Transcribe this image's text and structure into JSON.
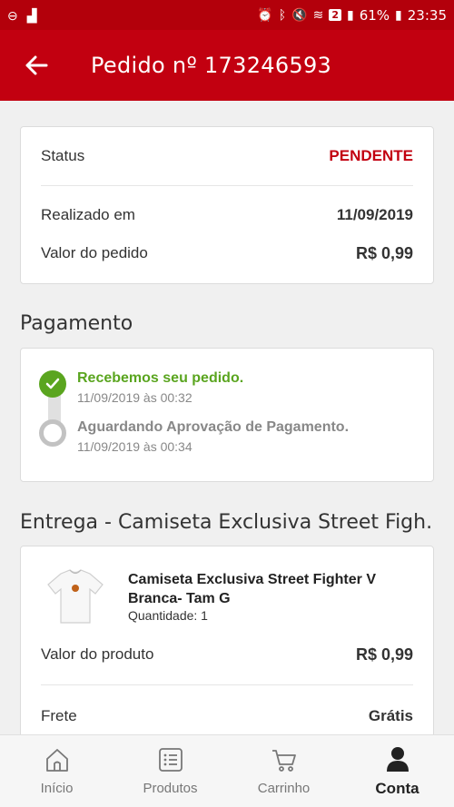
{
  "status_bar": {
    "battery": "61%",
    "time": "23:35",
    "notif_badge": "2"
  },
  "header": {
    "title": "Pedido nº 173246593"
  },
  "order": {
    "status_label": "Status",
    "status_value": "PENDENTE",
    "date_label": "Realizado em",
    "date_value": "11/09/2019",
    "total_label": "Valor do pedido",
    "total_value": "R$ 0,99"
  },
  "payment": {
    "section_title": "Pagamento",
    "steps": [
      {
        "title": "Recebemos seu pedido.",
        "date": "11/09/2019 às 00:32",
        "done": true
      },
      {
        "title": "Aguardando Aprovação de Pagamento.",
        "date": "11/09/2019 às 00:34",
        "done": false
      }
    ]
  },
  "delivery": {
    "section_title": "Entrega - Camiseta Exclusiva Street Figh...",
    "product_name": "Camiseta Exclusiva Street Fighter V Branca- Tam G",
    "quantity": "Quantidade: 1",
    "product_value_label": "Valor do produto",
    "product_value": "R$ 0,99",
    "shipping_label": "Frete",
    "shipping_value": "Grátis"
  },
  "bottom_nav": {
    "items": [
      {
        "label": "Início",
        "icon": "home-icon"
      },
      {
        "label": "Produtos",
        "icon": "list-icon"
      },
      {
        "label": "Carrinho",
        "icon": "cart-icon"
      },
      {
        "label": "Conta",
        "icon": "user-icon",
        "active": true
      }
    ]
  },
  "colors": {
    "brand_red": "#c20010",
    "status_pending": "#c20010",
    "step_done": "#5aa51f",
    "step_pending": "#bdbdbd"
  }
}
